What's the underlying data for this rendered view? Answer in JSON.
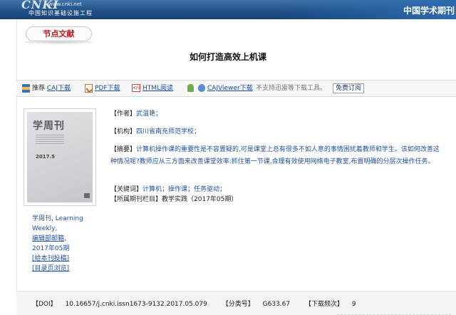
{
  "header": {
    "logo_text": "CNKI",
    "logo_url": "www.cnki.net",
    "logo_sub": "中国知识基础设施工程",
    "site_title": "中国学术期刊"
  },
  "section_tag": "节点文献",
  "article": {
    "title": "如何打造高效上机课"
  },
  "toolbar": {
    "recommend_label": "推荐",
    "caj_download": "CAJ下载",
    "pdf_download": "PDF下载",
    "html_read": "HTML阅读",
    "cajviewer_download": "CAJViewer下载",
    "no_thunder_note": "不支持迅雷等下载工具。",
    "subscribe": "免费订阅"
  },
  "cover": {
    "logo": "学周刊",
    "issue": "2017.5"
  },
  "journal": {
    "name_cn": "学周刊",
    "name_sep": ",",
    "name_en_1": "Learning",
    "name_en_2": "Weekly,",
    "editorial_mailbox": "编辑部邮箱",
    "issue": "2017年05期",
    "submit_link": "[给本刊投稿]",
    "toc_link": "[目录页浏览]"
  },
  "meta": {
    "author_label": "【作者】",
    "author": "武温艳；",
    "org_label": "【机构】",
    "org": "四川省南充师范学校；",
    "abstract_label": "【摘要】",
    "abstract": "计算机操作课的重要性是不容置疑的,可是课堂上总有很多不如人意的事情困扰着教师和学生。该如何改善这种情况呢?教师应从三方面来改善课堂效率:抓住第一节课,合理有效使用网络电子教室,布置明确的分层次操作任务。",
    "keywords_label": "【关键词】",
    "keywords": [
      "计算机；",
      "操作课；",
      "任务驱动；"
    ],
    "column_label": "【所属期刊栏目】",
    "column": "教学实践（2017年05期）"
  },
  "footer": {
    "doi_label": "【DOI】",
    "doi": "10.16657/j.cnki.issn1673-9132.2017.05.079",
    "class_label": "【分类号】",
    "class_code": "G633.67",
    "downloads_label": "【下载频次】",
    "downloads": "9"
  }
}
